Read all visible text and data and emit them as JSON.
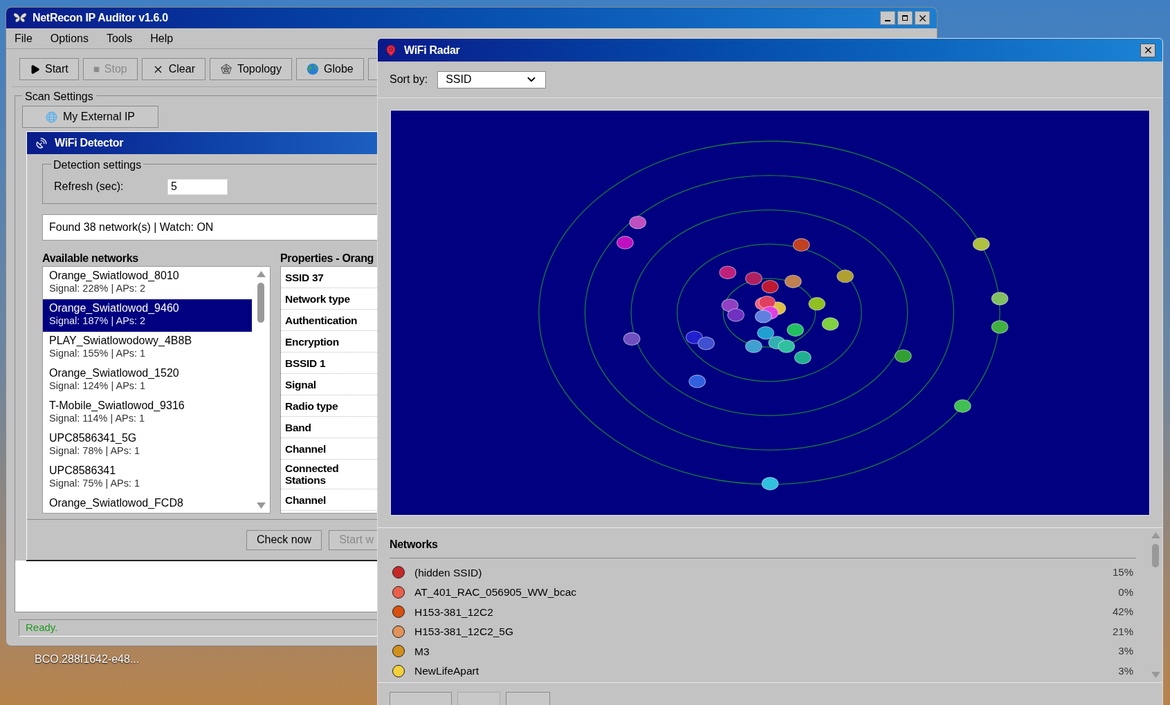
{
  "desktop": {
    "icon_labels": [
      {
        "label": "BCO.288f1642-e48..."
      }
    ]
  },
  "main_window": {
    "title": "NetRecon IP Auditor v1.6.0",
    "menu": [
      "File",
      "Options",
      "Tools",
      "Help"
    ],
    "toolbar": [
      {
        "kind": "play",
        "label": "Start",
        "disabled": false
      },
      {
        "kind": "stop",
        "label": "Stop",
        "disabled": true
      },
      {
        "kind": "clear",
        "label": "Clear",
        "disabled": false
      },
      {
        "kind": "topology",
        "label": "Topology",
        "disabled": false
      },
      {
        "kind": "globe",
        "label": "Globe",
        "disabled": false
      }
    ],
    "scan_settings": {
      "title": "Scan Settings",
      "external_ip_button": "My External IP"
    },
    "status_bar": "Ready."
  },
  "wifi_detector": {
    "title": "WiFi Detector",
    "detection_settings": {
      "title": "Detection settings",
      "refresh_label": "Refresh (sec):",
      "refresh_value": "5"
    },
    "summary": "Found 38 network(s) | Watch: ON",
    "networks_heading": "Available networks",
    "networks": [
      {
        "ssid": "Orange_Swiatlowod_8010",
        "details": "Signal: 228% | APs: 2",
        "selected": false
      },
      {
        "ssid": "Orange_Swiatlowod_9460",
        "details": "Signal: 187% | APs: 2",
        "selected": true
      },
      {
        "ssid": "PLAY_Swiatlowodowy_4B8B",
        "details": "Signal: 155% | APs: 1",
        "selected": false
      },
      {
        "ssid": "Orange_Swiatlowod_1520",
        "details": "Signal: 124% | APs: 1",
        "selected": false
      },
      {
        "ssid": "T-Mobile_Swiatlowod_9316",
        "details": "Signal: 114% | APs: 1",
        "selected": false
      },
      {
        "ssid": "UPC8586341_5G",
        "details": "Signal: 78% | APs: 1",
        "selected": false
      },
      {
        "ssid": "UPC8586341",
        "details": "Signal: 75% | APs: 1",
        "selected": false
      },
      {
        "ssid": "Orange_Swiatlowod_FCD8",
        "selected": false
      }
    ],
    "properties_heading": "Properties - Orang",
    "properties": [
      "SSID 37",
      "Network type",
      "Authentication",
      "Encryption",
      "BSSID 1",
      "Signal",
      "Radio type",
      "Band",
      "Channel",
      "Connected Stations",
      "Channel"
    ],
    "buttons": [
      {
        "label": "Check now",
        "disabled": false
      },
      {
        "label": "Start w",
        "disabled": true
      }
    ]
  },
  "wifi_radar": {
    "title": "WiFi Radar",
    "sort_label": "Sort by:",
    "sort_value": "SSID",
    "networks_heading": "Networks",
    "networks": [
      {
        "name": "(hidden SSID)",
        "color": "#c62828",
        "signal": "15%"
      },
      {
        "name": "AT_401_RAC_056905_WW_bcac",
        "color": "#e8604c",
        "signal": "0%"
      },
      {
        "name": "H153-381_12C2",
        "color": "#d84f10",
        "signal": "42%"
      },
      {
        "name": "H153-381_12C2_5G",
        "color": "#e0935a",
        "signal": "21%"
      },
      {
        "name": "M3",
        "color": "#d0901c",
        "signal": "3%"
      },
      {
        "name": "NewLifeApart",
        "color": "#f2d03c",
        "signal": "3%"
      }
    ]
  }
}
